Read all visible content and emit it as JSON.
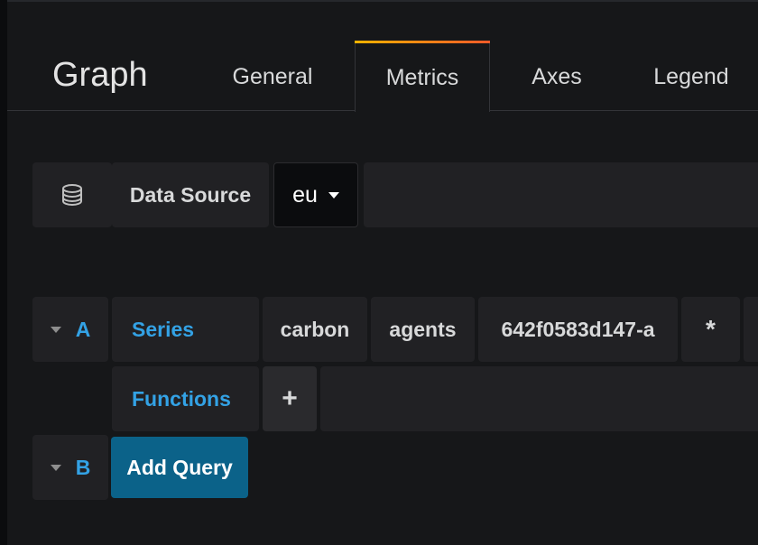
{
  "header": {
    "title": "Graph",
    "tabs": [
      {
        "label": "General",
        "active": false
      },
      {
        "label": "Metrics",
        "active": true
      },
      {
        "label": "Axes",
        "active": false
      },
      {
        "label": "Legend",
        "active": false
      }
    ]
  },
  "datasource": {
    "icon": "database-icon",
    "label": "Data Source",
    "selected": "eu"
  },
  "queries": [
    {
      "ref_id": "A",
      "series_label": "Series",
      "segments": [
        "carbon",
        "agents",
        "642f0583d147-a",
        "*"
      ],
      "functions_label": "Functions",
      "add_function": "+"
    },
    {
      "ref_id": "B",
      "add_query_label": "Add Query"
    }
  ],
  "colors": {
    "background": "#161719",
    "panel": "#212124",
    "link_blue": "#33a2e5",
    "primary_button": "#0b6289",
    "tab_indicator_start": "#fbb300",
    "tab_indicator_end": "#f05a28"
  }
}
